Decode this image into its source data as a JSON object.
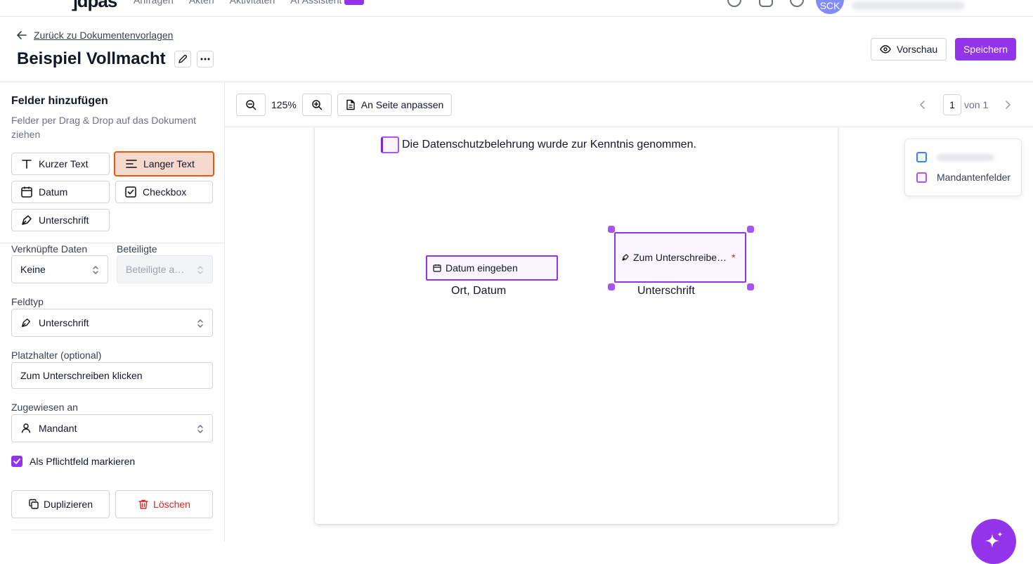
{
  "topnav": {
    "logo": "]dpas",
    "links": [
      "Anfragen",
      "Akten",
      "Aktivitäten",
      "AI Assistent"
    ],
    "avatar_initials": "SCK"
  },
  "header": {
    "back_label": "Zurück zu Dokumentenvorlagen",
    "title": "Beispiel Vollmacht",
    "preview_label": "Vorschau",
    "save_label": "Speichern"
  },
  "sidebar": {
    "title": "Felder hinzufügen",
    "subtitle": "Felder per Drag & Drop auf das Dokument ziehen",
    "field_types": {
      "short_text": "Kurzer Text",
      "long_text": "Langer Text",
      "date": "Datum",
      "checkbox": "Checkbox",
      "signature": "Unterschrift"
    },
    "linked_data_label": "Verknüpfte Daten",
    "linked_data_value": "Keine",
    "participants_label": "Beteiligte",
    "participants_placeholder": "Beteiligte a…",
    "fieldtype_label": "Feldtyp",
    "fieldtype_value": "Unterschrift",
    "placeholder_label": "Platzhalter (optional)",
    "placeholder_value": "Zum Unterschreiben klicken",
    "assigned_label": "Zugewiesen an",
    "assigned_value": "Mandant",
    "required_label": "Als Pflichtfeld markieren",
    "required_checked": true,
    "duplicate_label": "Duplizieren",
    "delete_label": "Löschen"
  },
  "toolbar": {
    "zoom": "125%",
    "fit_label": "An Seite anpassen",
    "page_current": "1",
    "page_of": "von 1"
  },
  "document": {
    "checkbox_text": "Die Datenschutzbelehrung wurde zur Kenntnis genommen.",
    "date_placeholder": "Datum eingeben",
    "date_caption": "Ort, Datum",
    "signature_placeholder": "Zum Unterschreibe…",
    "signature_required_mark": "*",
    "signature_caption": "Unterschrift"
  },
  "legend": {
    "items": [
      "Mandantenfelder"
    ]
  },
  "colors": {
    "accent": "#9333ea",
    "active_field_bg": "#f5d9cf",
    "active_field_border": "#ea580c",
    "delete": "#dc2626"
  }
}
